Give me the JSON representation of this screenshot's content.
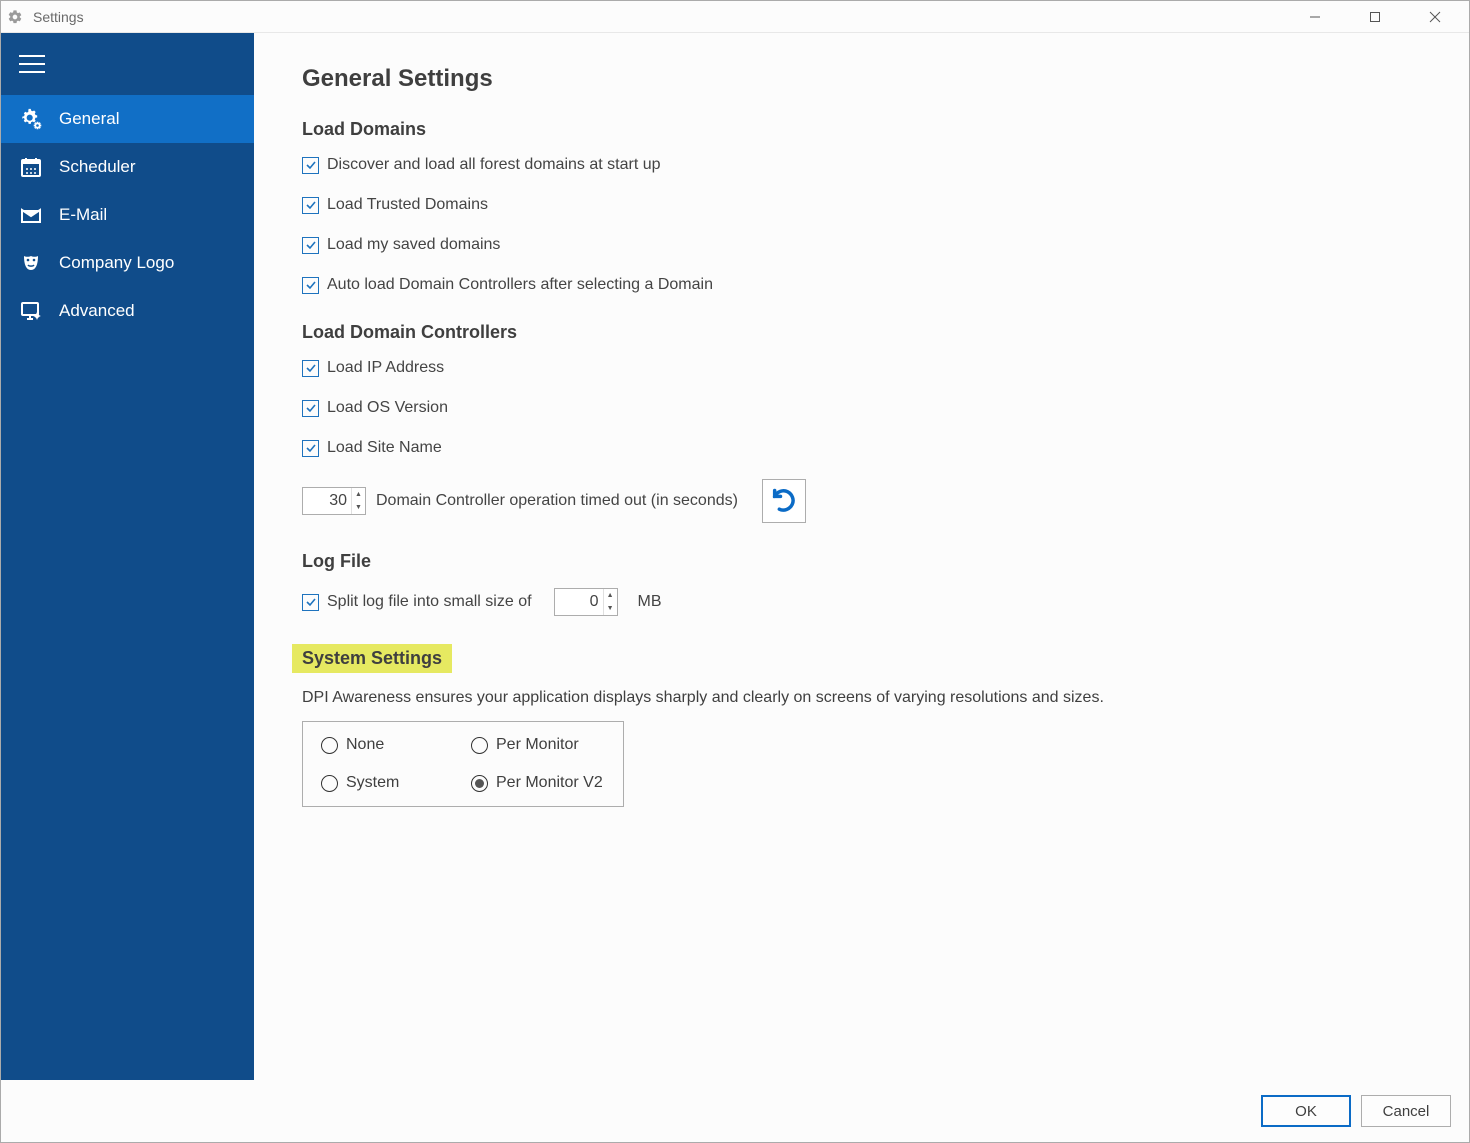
{
  "window": {
    "title": "Settings"
  },
  "sidebar": {
    "items": [
      {
        "key": "general",
        "label": "General"
      },
      {
        "key": "scheduler",
        "label": "Scheduler"
      },
      {
        "key": "email",
        "label": "E-Mail"
      },
      {
        "key": "logo",
        "label": "Company Logo"
      },
      {
        "key": "advanced",
        "label": "Advanced"
      }
    ],
    "active": "general"
  },
  "page": {
    "title": "General Settings",
    "sections": {
      "load_domains": {
        "heading": "Load Domains",
        "discover_label": "Discover and load all forest domains at start up",
        "trusted_label": "Load Trusted Domains",
        "saved_label": "Load my saved domains",
        "auto_dc_label": "Auto load Domain Controllers after selecting a Domain"
      },
      "load_dc": {
        "heading": "Load Domain Controllers",
        "ip_label": "Load IP Address",
        "os_label": "Load OS Version",
        "site_label": "Load Site Name",
        "timeout_value": "30",
        "timeout_label": "Domain Controller operation timed out (in seconds)"
      },
      "log_file": {
        "heading": "Log File",
        "split_label": "Split log file into small size of",
        "split_value": "0",
        "unit": "MB"
      },
      "system": {
        "heading": "System Settings",
        "dpi_text": "DPI Awareness ensures your application displays sharply and clearly on screens of varying resolutions and sizes.",
        "options": {
          "none": "None",
          "system": "System",
          "per_monitor": "Per Monitor",
          "per_monitor_v2": "Per Monitor V2"
        },
        "selected": "per_monitor_v2"
      }
    }
  },
  "footer": {
    "ok": "OK",
    "cancel": "Cancel"
  }
}
